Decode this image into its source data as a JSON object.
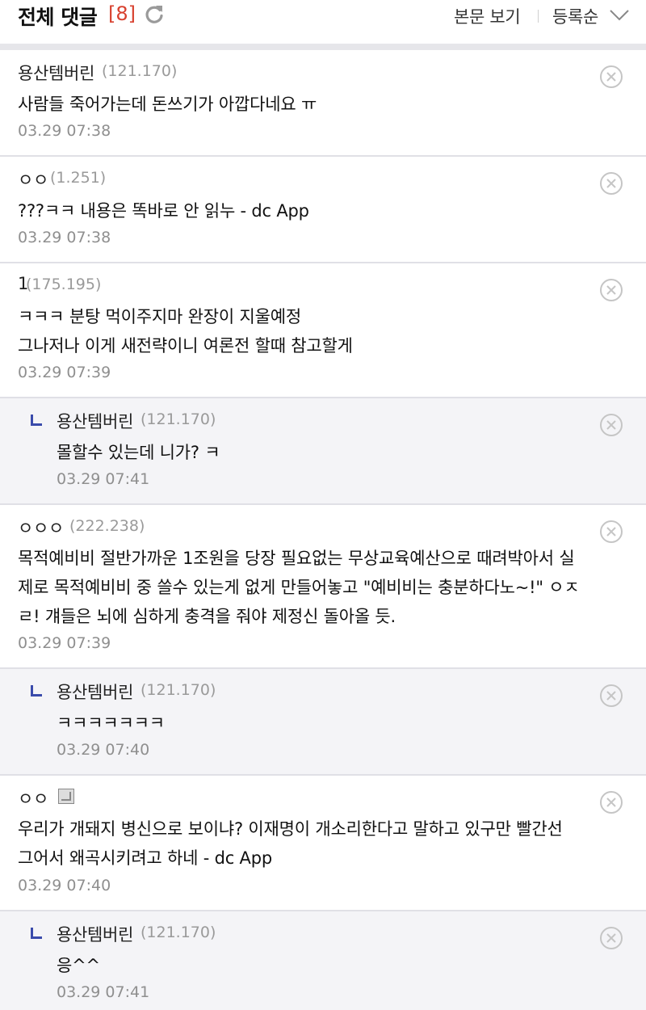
{
  "header": {
    "title": "전체 댓글",
    "count": "[8]",
    "view_post_label": "본문 보기",
    "sort_label": "등록순"
  },
  "comments": [
    {
      "nick": "용산템버린",
      "ip": "(121.170)",
      "body": [
        "사람들 죽어가는데 돈쓰기가 아깝다네요 ㅠ"
      ],
      "time": "03.29 07:38",
      "reply": false
    },
    {
      "nick": "ㅇㅇ",
      "ip": "(1.251)",
      "body": [
        "???ㅋㅋ 내용은 똑바로 안 읽누 - dc App"
      ],
      "time": "03.29 07:38",
      "reply": false
    },
    {
      "nick": "1",
      "ip": "(175.195)",
      "body": [
        "ㅋㅋㅋ 분탕 먹이주지마 완장이 지울예정",
        "그나저나 이게 새전략이니 여론전 할때 참고할게"
      ],
      "time": "03.29 07:39",
      "reply": false
    },
    {
      "nick": "용산템버린",
      "ip": "(121.170)",
      "body": [
        "몰할수 있는데 니가? ㅋ"
      ],
      "time": "03.29 07:41",
      "reply": true
    },
    {
      "nick": "ㅇㅇㅇ",
      "ip": "(222.238)",
      "body": [
        "목적예비비 절반가까운 1조원을 당장 필요없는 무상교육예산으로 때려박아서 실",
        "제로 목적예비비 중 쓸수 있는게 없게 만들어놓고 \"예비비는 충분하다노~!\" ㅇㅈ",
        "ㄹ! 걔들은 뇌에 심하게 충격을 줘야 제정신 돌아올 듯."
      ],
      "time": "03.29 07:39",
      "reply": false
    },
    {
      "nick": "용산템버린",
      "ip": "(121.170)",
      "body": [
        "ㅋㅋㅋㅋㅋㅋㅋ"
      ],
      "time": "03.29 07:40",
      "reply": true
    },
    {
      "nick": "ㅇㅇ",
      "ip": "",
      "body": [
        "우리가 개돼지 병신으로 보이냐? 이재명이 개소리한다고 말하고 있구만 빨간선",
        "그어서 왜곡시키려고 하네 - dc App"
      ],
      "time": "03.29 07:40",
      "reply": false,
      "gallog_icon": true
    },
    {
      "nick": "용산템버린",
      "ip": "(121.170)",
      "body": [
        "응^^"
      ],
      "time": "03.29 07:41",
      "reply": true
    }
  ]
}
